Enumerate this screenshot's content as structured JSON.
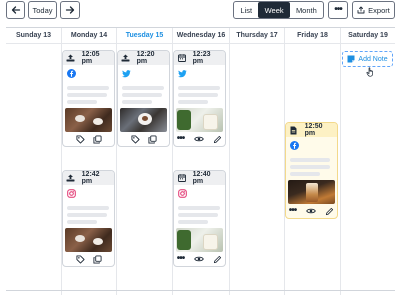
{
  "toolbar": {
    "back_label": "←",
    "today_label": "Today",
    "forward_label": "→",
    "views": [
      "List",
      "Week",
      "Month"
    ],
    "active_view": "Week",
    "more_label": "•••",
    "export_label": "Export"
  },
  "days": [
    {
      "label": "Sunday 13",
      "today": false
    },
    {
      "label": "Monday 14",
      "today": false
    },
    {
      "label": "Tuesday 15",
      "today": true
    },
    {
      "label": "Wednesday 16",
      "today": false
    },
    {
      "label": "Thursday 17",
      "today": false
    },
    {
      "label": "Friday 18",
      "today": false
    },
    {
      "label": "Saturday 19",
      "today": false
    }
  ],
  "posts": [
    {
      "day": "Monday 14",
      "time": "12:05 pm",
      "status_icon": "upload-icon",
      "network": "facebook",
      "photo": "coffee-cups",
      "actions": [
        "tag-icon",
        "copy-icon"
      ]
    },
    {
      "day": "Tuesday 15",
      "time": "12:20 pm",
      "status_icon": "upload-icon",
      "network": "twitter",
      "photo": "coffee-flowers",
      "actions": [
        "tag-icon",
        "copy-icon"
      ]
    },
    {
      "day": "Wednesday 16",
      "time": "12:23 pm",
      "status_icon": "calendar-icon",
      "network": "twitter",
      "photo": "matcha-latte",
      "actions": [
        "more-icon",
        "eye-icon",
        "pencil-icon"
      ]
    },
    {
      "day": "Monday 14",
      "time": "12:42 pm",
      "status_icon": "upload-icon",
      "network": "instagram",
      "photo": "coffee-cups",
      "actions": [
        "tag-icon",
        "copy-icon"
      ]
    },
    {
      "day": "Wednesday 16",
      "time": "12:40 pm",
      "status_icon": "calendar-icon",
      "network": "instagram",
      "photo": "matcha-latte",
      "actions": [
        "more-icon",
        "eye-icon",
        "pencil-icon"
      ]
    },
    {
      "day": "Friday 18",
      "time": "12:50 pm",
      "status_icon": "document-icon",
      "network": "facebook",
      "photo": "iced-coffee",
      "actions": [
        "more-icon",
        "eye-icon",
        "pencil-icon"
      ]
    }
  ],
  "add_note": {
    "label": "Add Note",
    "day": "Saturday 19"
  },
  "colors": {
    "accent": "#1d8fe1",
    "facebook": "#1877f2",
    "twitter": "#1da1f2",
    "instagram": "#e1306c",
    "note_bg": "#fffbea"
  }
}
